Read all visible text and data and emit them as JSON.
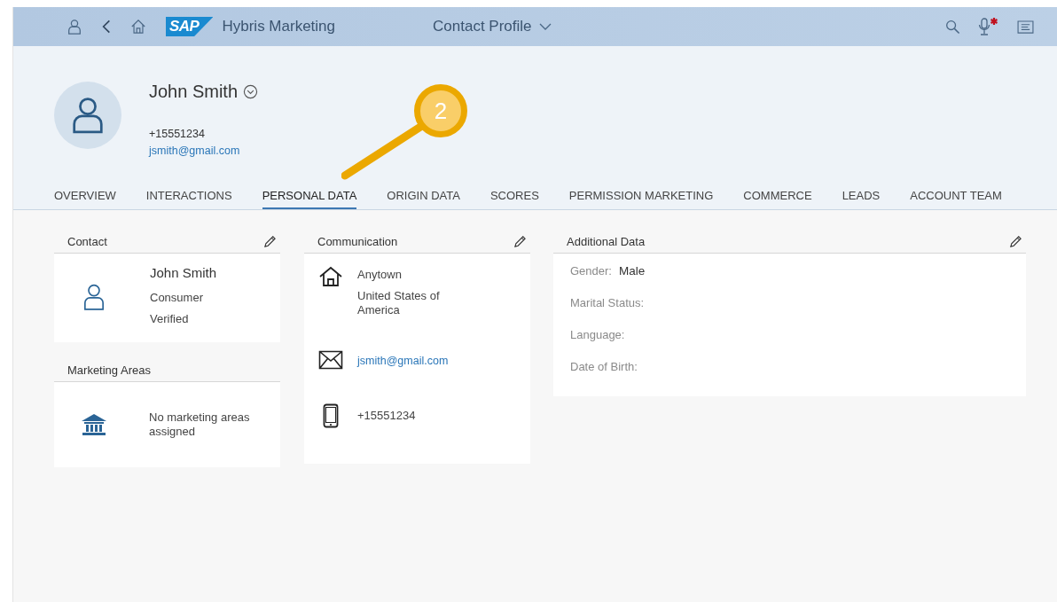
{
  "shell": {
    "logo": "SAP",
    "app_name": "Hybris Marketing",
    "page_title": "Contact Profile"
  },
  "profile": {
    "name": "John Smith",
    "phone": "+15551234",
    "email": "jsmith@gmail.com"
  },
  "annotation": {
    "number": "2"
  },
  "tabs": [
    {
      "label": "OVERVIEW",
      "selected": false
    },
    {
      "label": "INTERACTIONS",
      "selected": false
    },
    {
      "label": "PERSONAL DATA",
      "selected": true
    },
    {
      "label": "ORIGIN DATA",
      "selected": false
    },
    {
      "label": "SCORES",
      "selected": false
    },
    {
      "label": "PERMISSION MARKETING",
      "selected": false
    },
    {
      "label": "COMMERCE",
      "selected": false
    },
    {
      "label": "LEADS",
      "selected": false
    },
    {
      "label": "ACCOUNT TEAM",
      "selected": false
    }
  ],
  "contact_card": {
    "title": "Contact",
    "name": "John Smith",
    "type": "Consumer",
    "status": "Verified"
  },
  "marketing_areas": {
    "title": "Marketing Areas",
    "message": "No marketing areas assigned"
  },
  "communication": {
    "title": "Communication",
    "entries": [
      {
        "kind": "address",
        "lines": [
          "Anytown",
          "United States of America"
        ]
      },
      {
        "kind": "email",
        "lines": [
          "jsmith@gmail.com"
        ]
      },
      {
        "kind": "phone",
        "lines": [
          "+15551234"
        ]
      }
    ]
  },
  "additional_data": {
    "title": "Additional Data",
    "fields": [
      {
        "label": "Gender:",
        "value": "Male"
      },
      {
        "label": "Marital Status:"
      },
      {
        "label": "Language:"
      },
      {
        "label": "Date of Birth:"
      }
    ]
  }
}
